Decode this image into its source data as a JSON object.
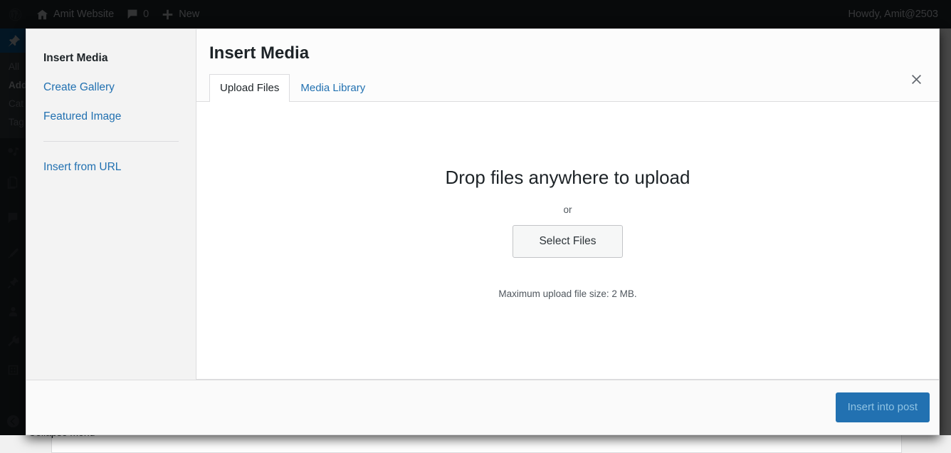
{
  "adminbar": {
    "logo_icon": "wordpress-logo-icon",
    "site_icon": "home-icon",
    "site_name": "Amit Website",
    "comments_icon": "comment-bubble-icon",
    "comment_count": "0",
    "new_icon": "plus-icon",
    "new_label": "New",
    "howdy": "Howdy, Amit@2503"
  },
  "adminmenu": {
    "posts_icon": "pin-icon",
    "submenu": [
      {
        "label": "All",
        "current": false
      },
      {
        "label": "Add",
        "current": true
      },
      {
        "label": "Cat",
        "current": false
      },
      {
        "label": "Tag",
        "current": false
      }
    ],
    "icons": [
      "media-icon",
      "pages-icon",
      "comments-icon",
      "appearance-icon",
      "plugins-icon",
      "users-icon",
      "tools-icon",
      "settings-icon"
    ],
    "collapse_icon": "collapse-arrow-icon",
    "collapse_label": "Collapse menu"
  },
  "modal": {
    "title": "Insert Media",
    "close_icon": "close-icon",
    "menu": [
      {
        "label": "Insert Media",
        "active": true
      },
      {
        "label": "Create Gallery",
        "active": false
      },
      {
        "label": "Featured Image",
        "active": false
      },
      {
        "label": "Insert from URL",
        "active": false
      }
    ],
    "tabs": [
      {
        "label": "Upload Files",
        "active": true
      },
      {
        "label": "Media Library",
        "active": false
      }
    ],
    "uploader": {
      "drop_heading": "Drop files anywhere to upload",
      "or_text": "or",
      "select_files_label": "Select Files",
      "max_upload_text": "Maximum upload file size: 2 MB."
    },
    "footer": {
      "insert_label": "Insert into post"
    }
  },
  "colors": {
    "accent": "#2271b1",
    "adminbar_bg": "#1d2327",
    "menu_highlight": "#0a4b78",
    "link": "#2271b1"
  }
}
